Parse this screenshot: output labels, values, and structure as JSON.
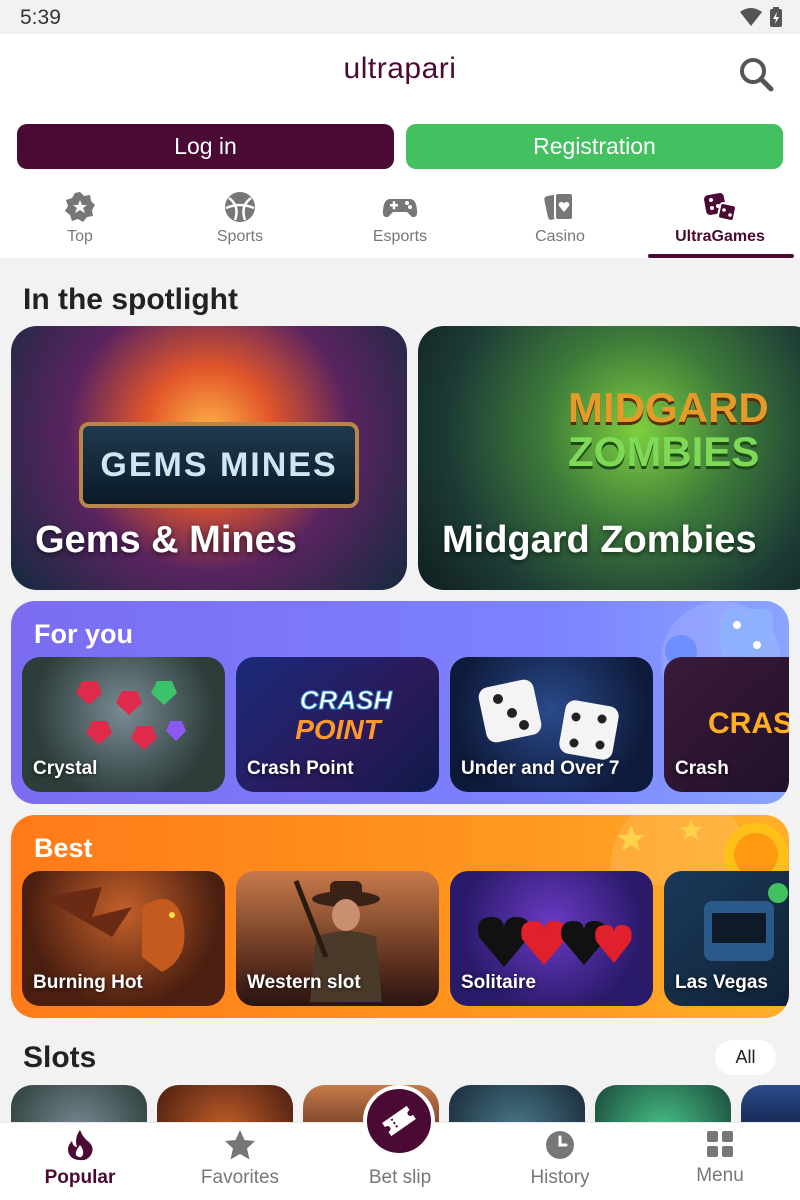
{
  "status": {
    "time": "5:39"
  },
  "header": {
    "logo": "ultrapari"
  },
  "auth": {
    "login_label": "Log in",
    "registration_label": "Registration"
  },
  "nav_tabs": [
    {
      "label": "Top",
      "icon": "gear-badge-icon"
    },
    {
      "label": "Sports",
      "icon": "ball-icon"
    },
    {
      "label": "Esports",
      "icon": "gamepad-icon"
    },
    {
      "label": "Casino",
      "icon": "cards-icon"
    },
    {
      "label": "UltraGames",
      "icon": "dice-icon",
      "active": true
    }
  ],
  "spotlight": {
    "title": "In the spotlight",
    "items": [
      {
        "name": "Gems & Mines",
        "art_text": "GEMS MINES"
      },
      {
        "name": "Midgard Zombies",
        "art_line1": "MIDGARD",
        "art_line2": "ZOMBIES"
      }
    ]
  },
  "for_you": {
    "title": "For you",
    "items": [
      "Crystal",
      "Crash Point",
      "Under and Over 7",
      "Crash"
    ]
  },
  "best": {
    "title": "Best",
    "items": [
      "Burning Hot",
      "Western slot",
      "Solitaire",
      "Las Vegas"
    ]
  },
  "slots": {
    "title": "Slots",
    "all_label": "All"
  },
  "bottom_nav": [
    {
      "label": "Popular",
      "icon": "flame-icon",
      "active": true
    },
    {
      "label": "Favorites",
      "icon": "star-icon"
    },
    {
      "label": "Bet slip",
      "icon": "ticket-icon"
    },
    {
      "label": "History",
      "icon": "clock-icon"
    },
    {
      "label": "Menu",
      "icon": "grid-icon"
    }
  ],
  "colors": {
    "brand": "#4a0a34",
    "registration": "#43c060",
    "for_you_band": "#7b6cf0",
    "best_band": "#ff8a1a"
  }
}
